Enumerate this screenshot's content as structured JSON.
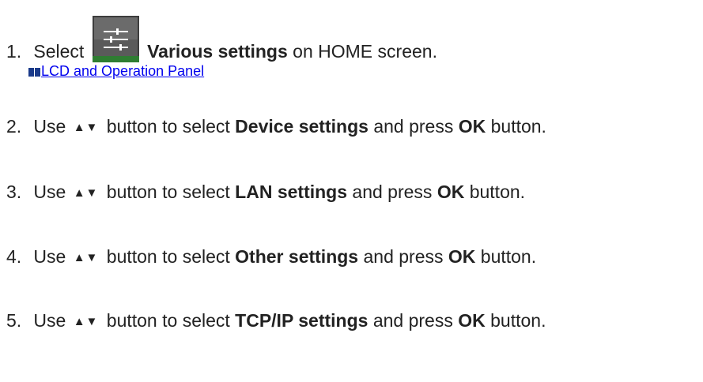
{
  "steps": [
    {
      "number": "1.",
      "pre": "Select",
      "icon": "various-settings-icon",
      "bold": "Various settings",
      "post": "on HOME screen."
    },
    {
      "number": "2.",
      "pre": "Use",
      "arrows": "▲▼",
      "mid": "button to select",
      "bold": "Device settings",
      "mid2": "and press",
      "bold2": "OK",
      "post": "button."
    },
    {
      "number": "3.",
      "pre": "Use",
      "arrows": "▲▼",
      "mid": "button to select",
      "bold": "LAN settings",
      "mid2": "and press",
      "bold2": "OK",
      "post": "button."
    },
    {
      "number": "4.",
      "pre": "Use",
      "arrows": "▲▼",
      "mid": "button to select",
      "bold": "Other settings",
      "mid2": "and press",
      "bold2": "OK",
      "post": "button."
    },
    {
      "number": "5.",
      "pre": "Use",
      "arrows": "▲▼",
      "mid": "button to select",
      "bold": "TCP/IP settings",
      "mid2": "and press",
      "bold2": "OK",
      "post": "button."
    }
  ],
  "link": {
    "icon": "book-link-icon",
    "text": "LCD and Operation Panel"
  },
  "colors": {
    "text": "#222222",
    "link": "#0000ee",
    "icon_bg": "#4a4a4a",
    "icon_accent": "#2f7d32"
  }
}
